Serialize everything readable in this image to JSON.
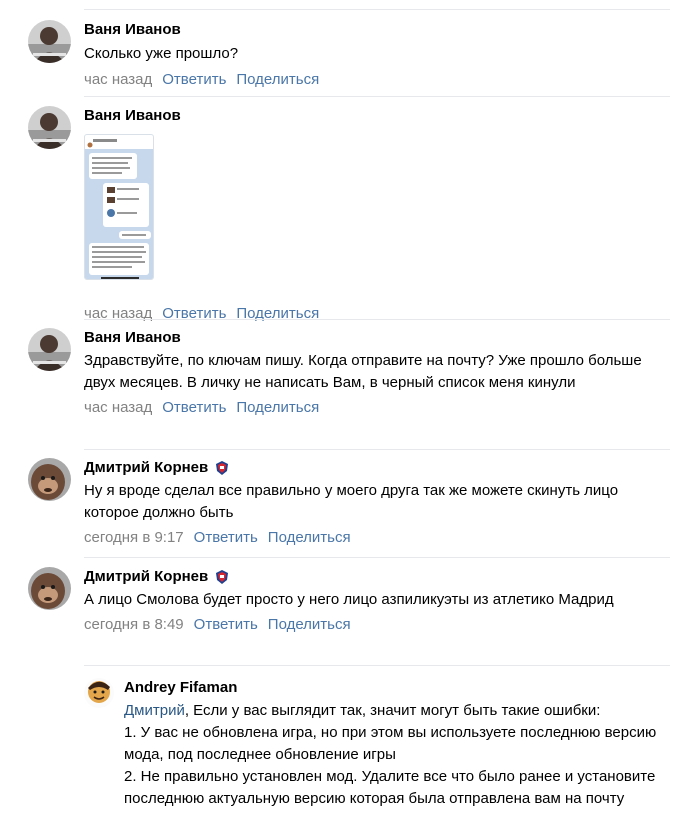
{
  "comments": [
    {
      "author": "Ваня Иванов",
      "text": "Сколько уже прошло?",
      "time": "час назад",
      "reply": "Ответить",
      "share": "Поделиться"
    },
    {
      "author": "Ваня Иванов",
      "text": "",
      "time": "час назад",
      "reply": "Ответить",
      "share": "Поделиться"
    },
    {
      "author": "Ваня Иванов",
      "text": "Здравствуйте, по ключам пишу. Когда отправите на почту? Уже прошло больше двух месяцев. В личку не написать Вам, в черный список меня кинули",
      "time": "час назад",
      "reply": "Ответить",
      "share": "Поделиться"
    },
    {
      "author": "Дмитрий Корнев",
      "text": "Ну я вроде сделал все правильно у моего друга так же можете скинуть лицо которое должно быть",
      "time": "сегодня в 9:17",
      "reply": "Ответить",
      "share": "Поделиться"
    },
    {
      "author": "Дмитрий Корнев",
      "text": "А лицо Смолова будет просто у него лицо азпиликуэты из атлетико Мадрид",
      "time": "сегодня в 8:49",
      "reply": "Ответить",
      "share": "Поделиться"
    }
  ],
  "reply_comment": {
    "author": "Andrey Fifaman",
    "mention": "Дмитрий",
    "text_lines": [
      ", Если у вас выглядит так, значит могут быть такие ошибки:",
      "1. У вас не обновлена игра, но при этом вы используете последнюю версию мода, под последнее обновление игры",
      "2. Не правильно установлен мод. Удалите все что было ранее и установите последнюю актуальную версию которая была отправлена вам на почту"
    ]
  },
  "colors": {
    "link": "#4a76a8",
    "muted": "#828282",
    "divider": "#e7e8ec"
  }
}
